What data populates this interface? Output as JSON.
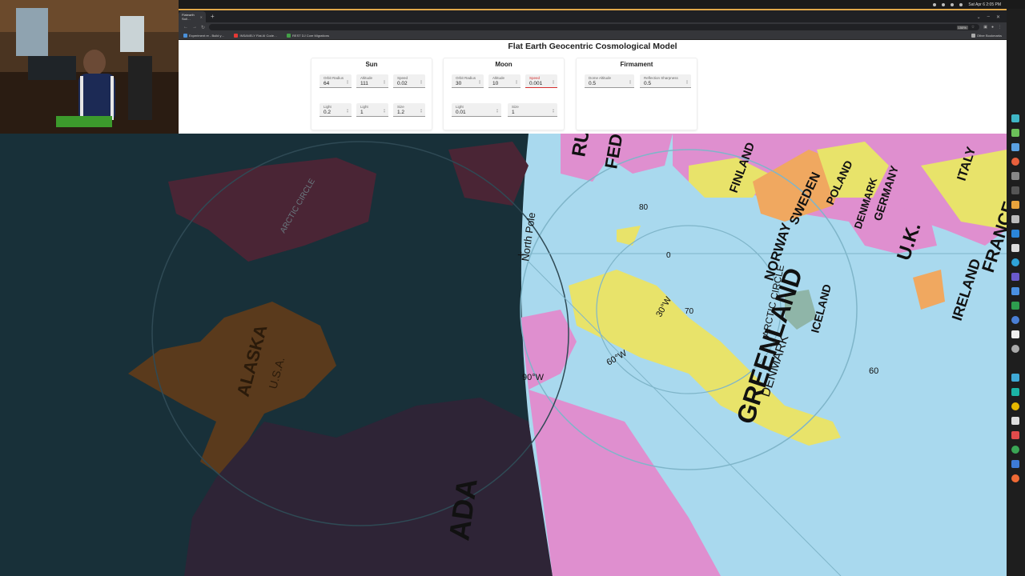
{
  "os_bar": {
    "clock": "Sat Apr 6   2:05 PM"
  },
  "browser": {
    "tabs": [
      {
        "label": "Flatearth Sol/…"
      },
      {
        "label": "Experiment re - Build y…"
      },
      {
        "label": "INSANELY Flat AI Code…"
      },
      {
        "label": "REST DJ Core Migrations"
      }
    ],
    "active_tab": "Flatearth Sol/…",
    "zoom": "150%",
    "bookmarks": [
      {
        "label": "Experiment re - Build y…",
        "color": "#4a90d9"
      },
      {
        "label": "INSANELY Flat AI Code…",
        "color": "#e53935"
      },
      {
        "label": "REST DJ Core Migrations",
        "color": "#43a047"
      }
    ],
    "other_bookmarks": "Other Bookmarks"
  },
  "page": {
    "title": "Flat Earth Geocentric Cosmological Model",
    "panels": [
      {
        "title": "Sun",
        "fields": [
          {
            "label": "Orbit Radius",
            "value": "64"
          },
          {
            "label": "Altitude",
            "value": "111"
          },
          {
            "label": "Speed",
            "value": "0.02"
          },
          {
            "label": "Light",
            "value": "0.2"
          },
          {
            "label": "Light",
            "value": "1"
          },
          {
            "label": "Size",
            "value": "1.2"
          }
        ]
      },
      {
        "title": "Moon",
        "fields": [
          {
            "label": "Orbit Radius",
            "value": "30"
          },
          {
            "label": "Altitude",
            "value": "10"
          },
          {
            "label": "Speed",
            "value": "0.001",
            "error": true
          },
          {
            "label": "Light",
            "value": "0.01"
          },
          {
            "label": "Size",
            "value": "1"
          }
        ]
      },
      {
        "title": "Firmament",
        "fields": [
          {
            "label": "Dome Altitude",
            "value": "0.5"
          },
          {
            "label": "Reflection Sharpness",
            "value": "0.5"
          }
        ]
      }
    ]
  },
  "map": {
    "labels": {
      "russia": "RUS",
      "federation": "FEDER",
      "north_pole": "North Pole",
      "arctic_circle_left": "ARCTIC CIRCLE",
      "arctic_circle_right": "ARCTIC CIRCLE",
      "alaska": "ALASKA",
      "usa": "U.S.A.",
      "canada": "ADA",
      "greenland": "GREENLAND",
      "denmark": "DENMARK",
      "iceland": "ICELAND",
      "norway": "NORWAY",
      "sweden": "SWEDEN",
      "finland": "FINLAND",
      "uk": "U.K.",
      "ireland": "IRELAND",
      "france": "FRANCE",
      "poland": "POLAND",
      "denmark_eu": "DENMARK",
      "germany": "GERMANY",
      "italy": "ITALY",
      "lat_80": "80",
      "lat_70": "70",
      "lat_60": "60",
      "lon_0": "0",
      "lon_30w": "30°W",
      "lon_60w": "60°W",
      "lon_90w": "90°W"
    },
    "colors": {
      "ocean": "#a9d9ee",
      "land_yellow": "#e8e36a",
      "land_pink": "#df8fcf",
      "land_orange": "#f0a860"
    }
  }
}
